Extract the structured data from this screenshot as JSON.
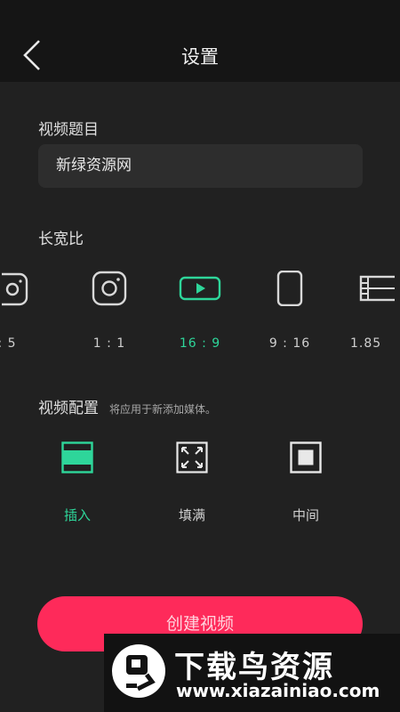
{
  "header": {
    "title": "设置",
    "back_icon": "chevron-left-icon"
  },
  "video_title": {
    "label": "视频题目",
    "value": "新绿资源网"
  },
  "aspect_ratio": {
    "label": "长宽比",
    "options": [
      {
        "label": ": 5",
        "icon": "instagram-icon"
      },
      {
        "label": "1 : 1",
        "icon": "instagram-icon"
      },
      {
        "label": "16 : 9",
        "icon": "youtube-icon",
        "selected": true
      },
      {
        "label": "9 : 16",
        "icon": "phone-portrait-icon"
      },
      {
        "label": "1.85",
        "icon": "film-icon"
      }
    ]
  },
  "video_config": {
    "label": "视频配置",
    "hint": "将应用于新添加媒体。",
    "options": [
      {
        "label": "插入",
        "icon": "fit-inset-icon",
        "selected": true
      },
      {
        "label": "填满",
        "icon": "fill-expand-icon"
      },
      {
        "label": "中间",
        "icon": "center-icon"
      }
    ]
  },
  "create_button": {
    "label": "创建视频"
  },
  "watermark": {
    "title": "下载鸟资源",
    "url": "www.xiazainiao.com"
  },
  "colors": {
    "accent": "#2ed69a",
    "primary_button": "#fe2a5a",
    "background": "#212121",
    "header": "#151515"
  }
}
